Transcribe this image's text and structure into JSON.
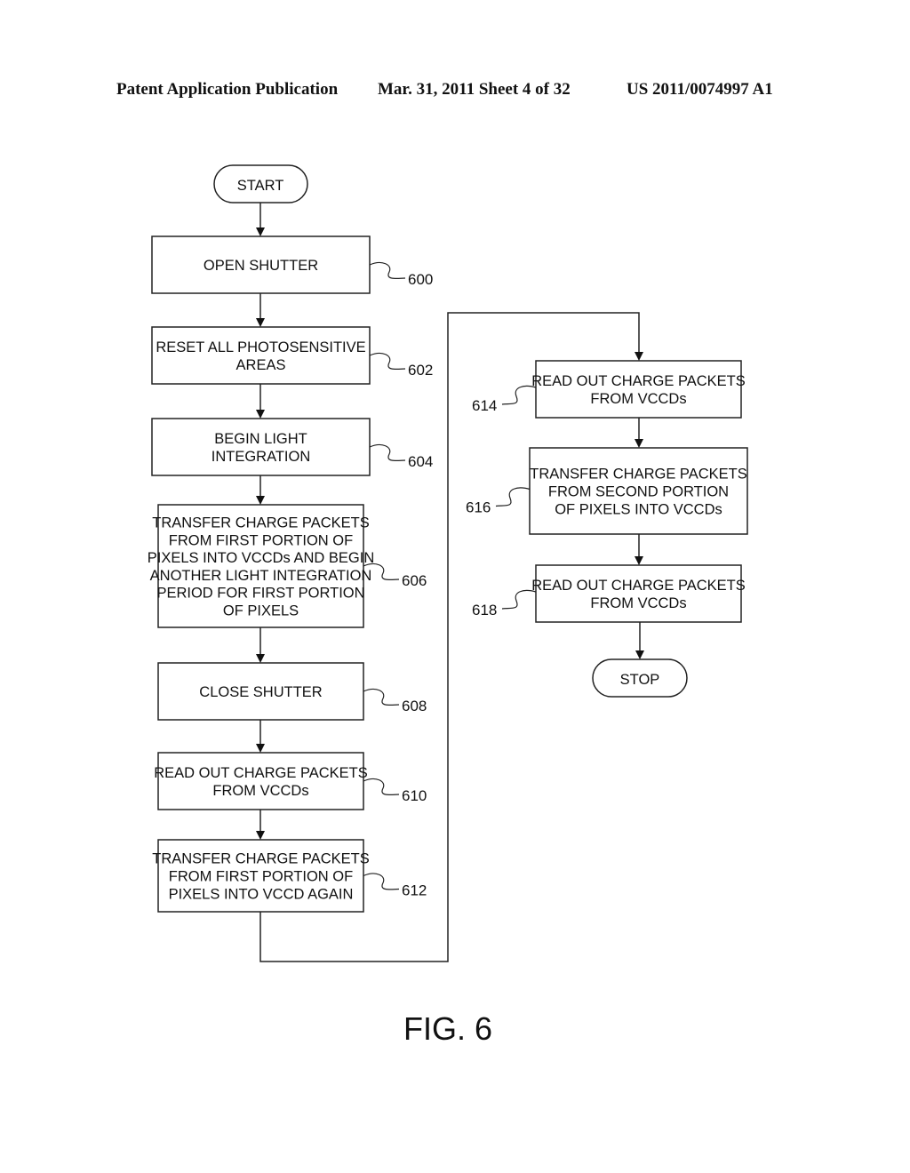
{
  "header": {
    "left": "Patent Application Publication",
    "middle": "Mar. 31, 2011  Sheet 4 of 32",
    "right": "US 2011/0074997 A1"
  },
  "flowchart": {
    "start": "START",
    "stop": "STOP",
    "steps": [
      {
        "ref": "600",
        "lines": [
          "OPEN SHUTTER"
        ]
      },
      {
        "ref": "602",
        "lines": [
          "RESET ALL PHOTOSENSITIVE",
          "AREAS"
        ]
      },
      {
        "ref": "604",
        "lines": [
          "BEGIN LIGHT",
          "INTEGRATION"
        ]
      },
      {
        "ref": "606",
        "lines": [
          "TRANSFER CHARGE PACKETS",
          "FROM FIRST PORTION OF",
          "PIXELS INTO VCCDs AND BEGIN",
          "ANOTHER LIGHT INTEGRATION",
          "PERIOD FOR FIRST PORTION",
          "OF PIXELS"
        ]
      },
      {
        "ref": "608",
        "lines": [
          "CLOSE SHUTTER"
        ]
      },
      {
        "ref": "610",
        "lines": [
          "READ OUT CHARGE PACKETS",
          "FROM VCCDs"
        ]
      },
      {
        "ref": "612",
        "lines": [
          "TRANSFER CHARGE PACKETS",
          "FROM FIRST PORTION OF",
          "PIXELS INTO VCCD AGAIN"
        ]
      },
      {
        "ref": "614",
        "lines": [
          "READ OUT CHARGE PACKETS",
          "FROM VCCDs"
        ]
      },
      {
        "ref": "616",
        "lines": [
          "TRANSFER CHARGE PACKETS",
          "FROM SECOND PORTION",
          "OF PIXELS INTO VCCDs"
        ]
      },
      {
        "ref": "618",
        "lines": [
          "READ OUT CHARGE PACKETS",
          "FROM VCCDs"
        ]
      }
    ]
  },
  "figure_label": "FIG. 6"
}
